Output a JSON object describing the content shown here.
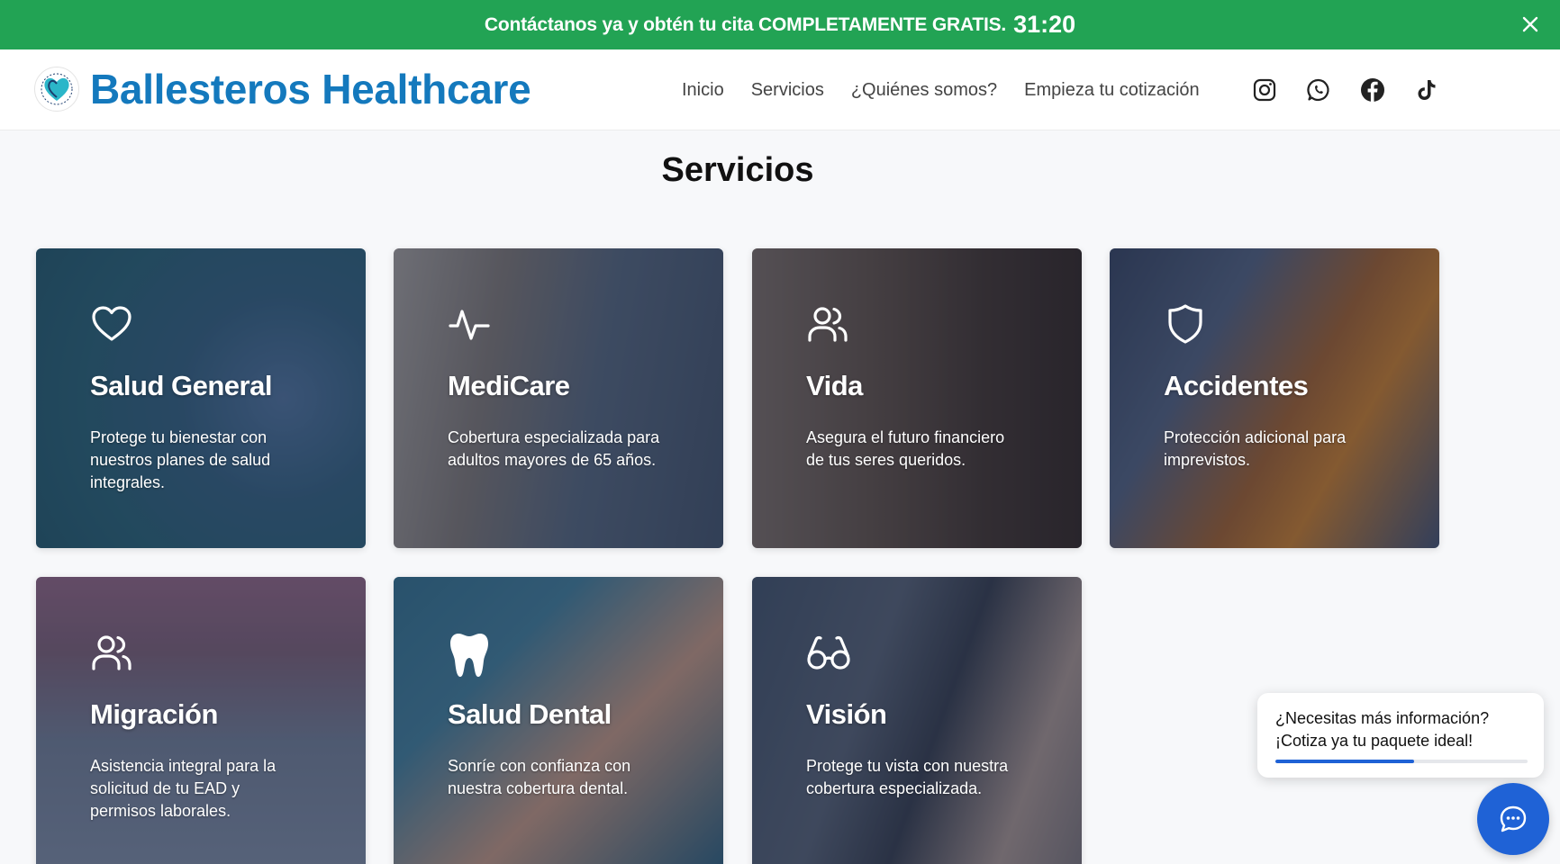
{
  "promo": {
    "text": "Contáctanos ya y obtén tu cita COMPLETAMENTE GRATIS.",
    "timer": "31:20",
    "close_icon": "close-icon"
  },
  "brand": {
    "name": "Ballesteros Healthcare",
    "color": "#1479bd"
  },
  "nav": {
    "items": [
      "Inicio",
      "Servicios",
      "¿Quiénes somos?",
      "Empieza tu cotización"
    ]
  },
  "social": [
    "instagram-icon",
    "whatsapp-icon",
    "facebook-icon",
    "tiktok-icon"
  ],
  "section": {
    "title": "Servicios"
  },
  "services": [
    {
      "title": "Salud General",
      "desc": "Protege tu bienestar con nuestros planes de salud integrales.",
      "icon": "heart-icon",
      "color": "#3f7d93"
    },
    {
      "title": "MediCare",
      "desc": "Cobertura especializada para adultos mayores de 65 años.",
      "icon": "activity-icon",
      "color": "#7b7268"
    },
    {
      "title": "Vida",
      "desc": "Asegura el futuro financiero de tus seres queridos.",
      "icon": "users-icon",
      "color": "#5c4a3d"
    },
    {
      "title": "Accidentes",
      "desc": "Protección adicional para imprevistos.",
      "icon": "shield-icon",
      "color": "#6a5a4a"
    },
    {
      "title": "Migración",
      "desc": "Asistencia integral para la solicitud de tu EAD y permisos laborales.",
      "icon": "users-icon",
      "color": "#7d6371"
    },
    {
      "title": "Salud Dental",
      "desc": "Sonríe con confianza con nuestra cobertura dental.",
      "icon": "tooth-icon",
      "color": "#3e6f86"
    },
    {
      "title": "Visión",
      "desc": "Protege tu vista con nuestra cobertura especializada.",
      "icon": "glasses-icon",
      "color": "#5b5f6c"
    }
  ],
  "chat": {
    "line1": "¿Necesitas más información?",
    "line2": "¡Cotiza ya tu paquete ideal!",
    "progress": 0.55,
    "color": "#1f62d6"
  },
  "colors": {
    "banner": "#22a354"
  }
}
